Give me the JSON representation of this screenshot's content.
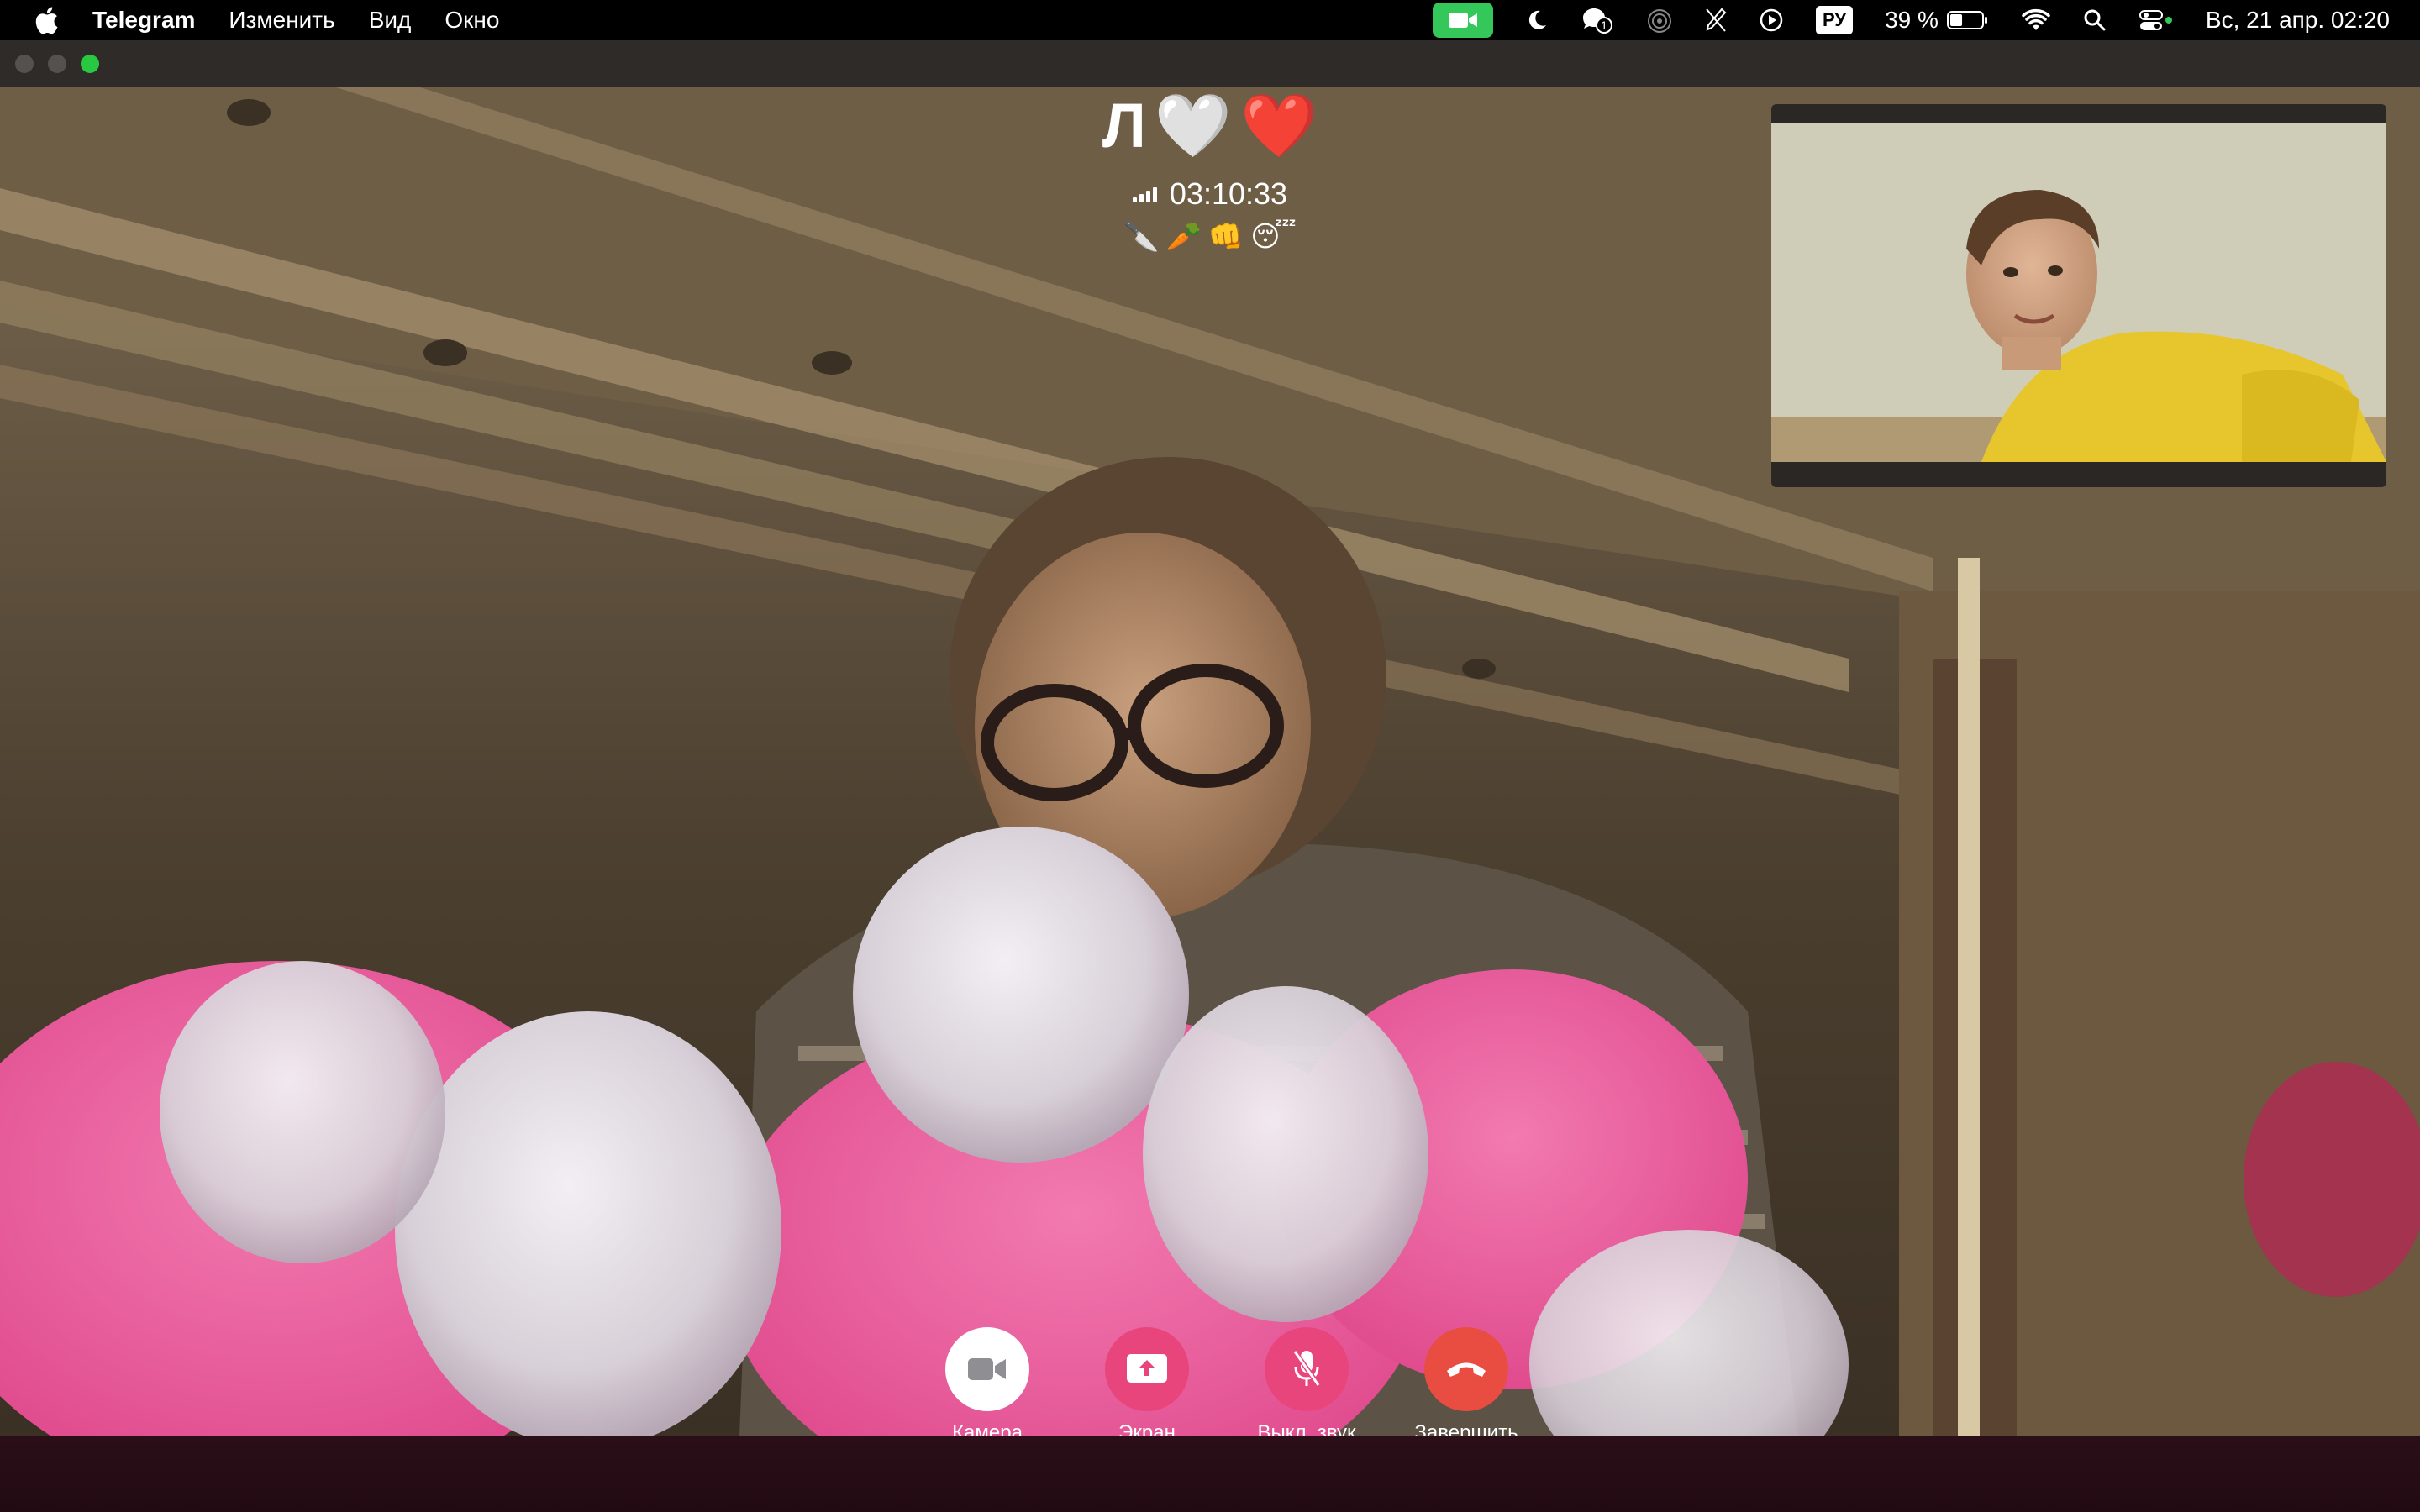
{
  "menubar": {
    "app_name": "Telegram",
    "items": [
      "Изменить",
      "Вид",
      "Окно"
    ],
    "status": {
      "camera_indicator_color": "#34c759",
      "notification_count": "1",
      "keyboard_layout": "РУ",
      "battery": "39 %",
      "battery_level": 0.39,
      "datetime": "Вс, 21 апр. 02:20"
    }
  },
  "call": {
    "peer_name": "Л",
    "peer_hearts": [
      "🤍",
      "❤️"
    ],
    "duration": "03:10:33",
    "signal_bars": 4,
    "encryption_emojis": [
      "🔪",
      "🥕",
      "👊",
      "😴"
    ]
  },
  "controls": [
    {
      "key": "camera",
      "label": "Камера",
      "color": "#ffffff",
      "icon": "video-camera-icon"
    },
    {
      "key": "screen",
      "label": "Экран",
      "color": "#e8457c",
      "icon": "screen-share-icon"
    },
    {
      "key": "mute",
      "label": "Выкл. звук",
      "color": "#e8457c",
      "icon": "mic-off-icon"
    },
    {
      "key": "end",
      "label": "Завершить",
      "color": "#e94d42",
      "icon": "phone-hangup-icon"
    }
  ]
}
